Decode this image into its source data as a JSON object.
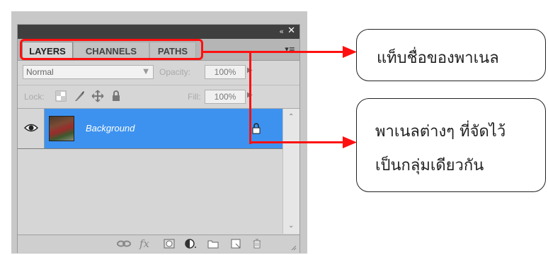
{
  "panel": {
    "collapse_glyph": "«",
    "close_glyph": "✕",
    "tabs": [
      {
        "label": "LAYERS",
        "active": true
      },
      {
        "label": "CHANNELS",
        "active": false
      },
      {
        "label": "PATHS",
        "active": false
      }
    ],
    "panel_menu_glyph": "▾≡",
    "blend_mode": "Normal",
    "opacity_label": "Opacity:",
    "opacity_value": "100%",
    "lock_label": "Lock:",
    "fill_label": "Fill:",
    "fill_value": "100%",
    "layers": [
      {
        "name": "Background",
        "visible": true,
        "locked": true,
        "selected": true
      }
    ],
    "bottom_icons": [
      "link-layers-icon",
      "fx-icon",
      "add-mask-icon",
      "adjustment-layer-icon",
      "new-group-icon",
      "new-layer-icon",
      "delete-layer-icon"
    ],
    "fx_label": "fx"
  },
  "callouts": {
    "tab_names": "แท็บชื่อของพาเนล",
    "grouped_line1": "พาเนลต่างๆ ที่จัดไว้",
    "grouped_line2": "เป็นกลุ่มเดียวกัน"
  },
  "colors": {
    "selected_layer": "#3d92ef",
    "annotation": "#ff1010",
    "titlebar": "#3f3f3f"
  }
}
